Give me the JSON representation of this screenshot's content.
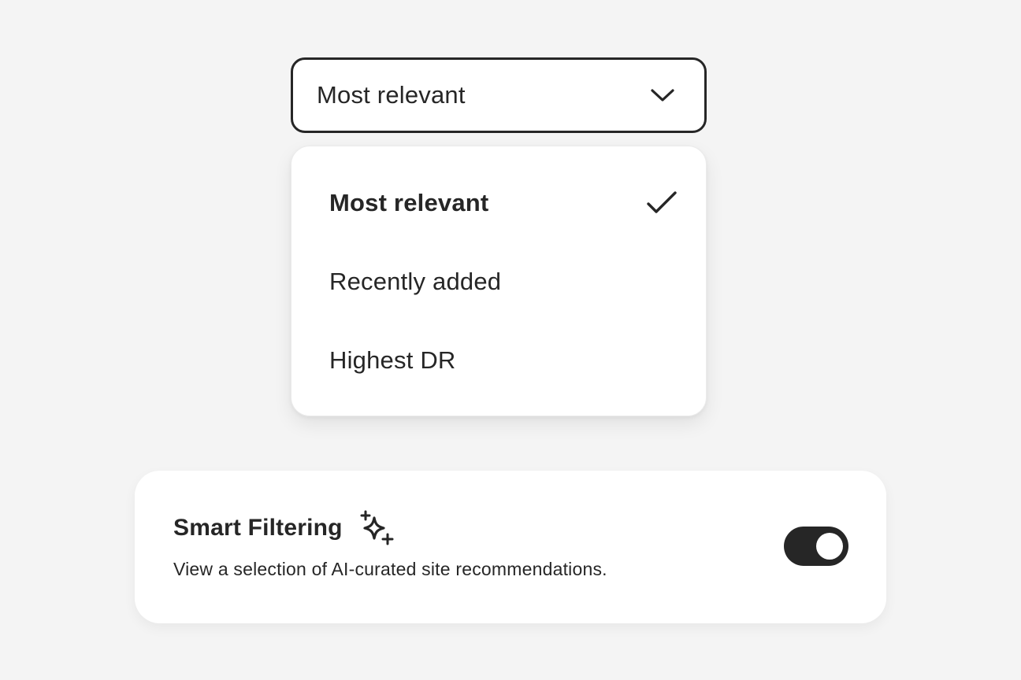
{
  "sort_select": {
    "selected_value": "Most relevant",
    "icon": "chevron-down-icon"
  },
  "sort_menu": {
    "items": [
      {
        "label": "Most relevant",
        "selected": true,
        "icon": "checkmark-icon"
      },
      {
        "label": "Recently added",
        "selected": false
      },
      {
        "label": "Highest DR",
        "selected": false
      }
    ]
  },
  "smart_filtering": {
    "title": "Smart Filtering",
    "title_icon": "sparkles-icon",
    "description": "View a selection of AI-curated site recommendations.",
    "toggle_on": true
  },
  "colors": {
    "background": "#f4f4f4",
    "surface": "#ffffff",
    "text": "#262626",
    "toggle_active": "#262626"
  }
}
